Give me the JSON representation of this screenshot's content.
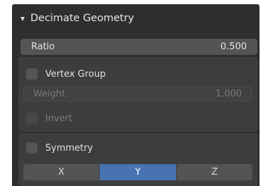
{
  "panel": {
    "title": "Decimate Geometry",
    "ratio_label": "Ratio",
    "ratio_value": "0.500",
    "vertex_group": {
      "label": "Vertex Group",
      "checked": false,
      "weight_label": "Weight",
      "weight_value": "1.000",
      "invert_label": "Invert",
      "invert_checked": false
    },
    "symmetry": {
      "label": "Symmetry",
      "checked": false,
      "axes": [
        "X",
        "Y",
        "Z"
      ],
      "selected_axis": "Y"
    }
  },
  "colors": {
    "panel_bg": "#2e2e2e",
    "field_bg": "#545454",
    "accent": "#4772b3"
  }
}
